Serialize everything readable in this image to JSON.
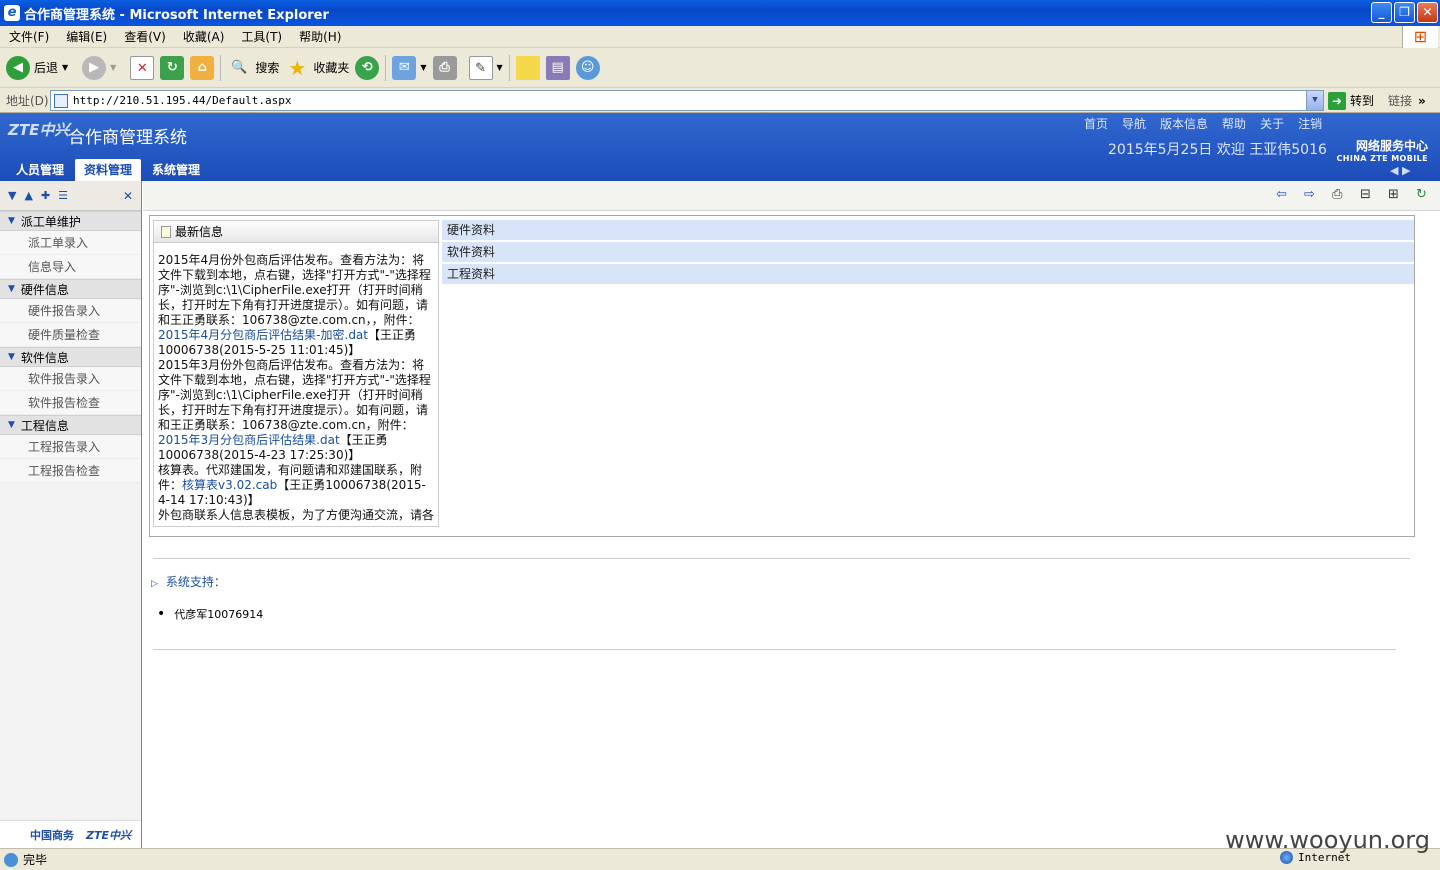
{
  "window": {
    "title": "合作商管理系统 - Microsoft Internet Explorer"
  },
  "menu": [
    "文件(F)",
    "编辑(E)",
    "查看(V)",
    "收藏(A)",
    "工具(T)",
    "帮助(H)"
  ],
  "toolbar": {
    "back": "后退",
    "search": "搜索",
    "favorites": "收藏夹"
  },
  "address": {
    "label": "地址(D)",
    "url": "http://210.51.195.44/Default.aspx",
    "go": "转到",
    "links": "链接"
  },
  "header": {
    "logo": "ZTE中兴",
    "title": "合作商管理系统",
    "nav": [
      "首页",
      "导航",
      "版本信息",
      "帮助",
      "关于",
      "注销"
    ],
    "welcome": "2015年5月25日 欢迎 王亚伟5016",
    "brand_cn": "网络服务中心",
    "brand_en": "CHINA ZTE MOBILE"
  },
  "tabs": [
    "人员管理",
    "资料管理",
    "系统管理"
  ],
  "sidebar": {
    "sections": [
      {
        "title": "派工单维护",
        "items": [
          "派工单录入",
          "信息导入"
        ]
      },
      {
        "title": "硬件信息",
        "items": [
          "硬件报告录入",
          "硬件质量检查"
        ]
      },
      {
        "title": "软件信息",
        "items": [
          "软件报告录入",
          "软件报告检查"
        ]
      },
      {
        "title": "工程信息",
        "items": [
          "工程报告录入",
          "工程报告检查"
        ]
      }
    ],
    "footer_left": "中国商务",
    "footer_right": "ZTE中兴"
  },
  "news": {
    "title": "最新信息",
    "p1": "2015年4月份外包商后评估发布。查看方法为：将文件下载到本地，点右键，选择\"打开方式\"-\"选择程序\"-浏览到c:\\1\\CipherFile.exe打开（打开时间稍长，打开时左下角有打开进度提示）。如有问题，请和王正勇联系：106738@zte.com.cn，，附件：",
    "l1": "2015年4月分包商后评估结果-加密.dat",
    "s1": "【王正勇10006738(2015-5-25 11:01:45)】",
    "p2": "2015年3月份外包商后评估发布。查看方法为：将文件下载到本地，点右键，选择\"打开方式\"-\"选择程序\"-浏览到c:\\1\\CipherFile.exe打开（打开时间稍长，打开时左下角有打开进度提示）。如有问题，请和王正勇联系：106738@zte.com.cn，附件：",
    "l2": "2015年3月分包商后评估结果.dat",
    "s2": "【王正勇10006738(2015-4-23 17:25:30)】",
    "p3": "核算表。代邓建国发，有问题请和邓建国联系，附件：",
    "l3": "核算表v3.02.cab",
    "s3": "【王正勇10006738(2015-4-14 17:10:43)】",
    "p4": "外包商联系人信息表模板，为了方便沟通交流，请各"
  },
  "categories": [
    "硬件资料",
    "软件资料",
    "工程资料"
  ],
  "support": {
    "title": "系统支持：",
    "contact": "代彦军10076914"
  },
  "status": {
    "text": "完毕",
    "zone": "Internet",
    "watermark": "www.wooyun.org"
  }
}
